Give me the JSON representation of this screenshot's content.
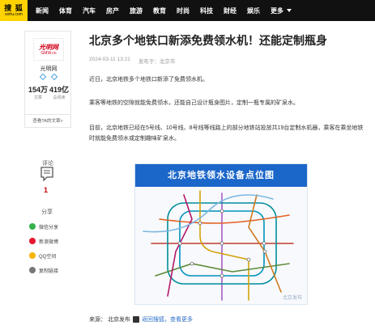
{
  "site": {
    "logo_cn": "搜 狐",
    "logo_en": "sohu.com"
  },
  "nav": {
    "items": [
      "新闻",
      "体育",
      "汽车",
      "房产",
      "旅游",
      "教育",
      "时尚",
      "科技",
      "财经",
      "娱乐"
    ],
    "more_label": "更多"
  },
  "author": {
    "avatar_text_cn": "光明网",
    "avatar_text_en": "GMW.cn",
    "name": "光明网",
    "articles_count": "154万",
    "articles_label": "文章",
    "views_count": "419亿",
    "views_label": "总阅读",
    "view_articles_label": "查看TA的文章>"
  },
  "comments": {
    "label": "评论",
    "count": "1"
  },
  "share": {
    "title": "分享",
    "items": [
      {
        "label": "微信分享",
        "color": "#33b04a"
      },
      {
        "label": "新浪微博",
        "color": "#e6162d"
      },
      {
        "label": "QQ空间",
        "color": "#f6b400"
      },
      {
        "label": "复制链接",
        "color": "#777777"
      }
    ]
  },
  "article": {
    "title": "北京多个地铁口新添免费领水机！还能定制瓶身",
    "time": "2024-03-11 13:21",
    "publisher": "发布于：北京市",
    "paragraphs": [
      "近日，北京地铁多个地铁口新添了免费领水机。",
      "乘客等地铁的空隙就能免费领水，还能自己设计瓶身图片，定制一瓶专属的矿泉水。",
      "目前，北京地铁已经在5号线、10号线、8号线等线路上的部分地铁站投放共19台定制水机器，乘客在乘坐地铁时就能免费领水或定制趣味矿泉水。"
    ]
  },
  "map": {
    "title": "北京地铁领水设备点位图",
    "watermark": "北京发布"
  },
  "source": {
    "label": "来源：",
    "name": "北京发布",
    "back_link": "返回搜狐，查看更多"
  },
  "colors": {
    "nav_bg": "#111111",
    "logo_bg": "#ffd200",
    "map_header": "#1b66c9",
    "accent_red": "#cc0000",
    "link_blue": "#2a6ec7"
  }
}
